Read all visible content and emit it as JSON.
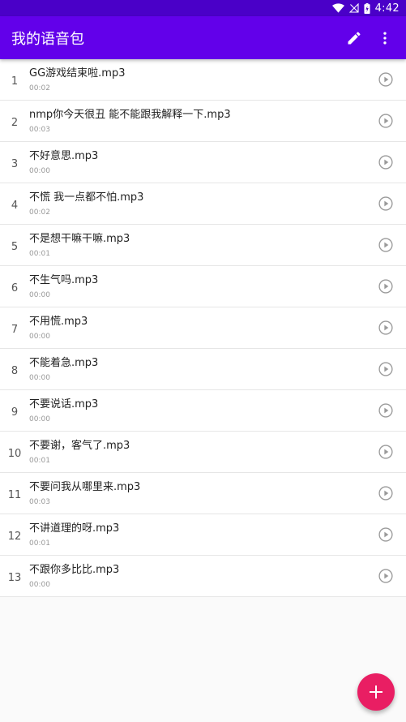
{
  "status_bar": {
    "time": "4:42",
    "icons": [
      "wifi-icon",
      "no-signal-icon",
      "battery-charging-icon"
    ]
  },
  "app_bar": {
    "title": "我的语音包",
    "actions": [
      "edit-icon",
      "more-vert-icon"
    ],
    "color": "#6200ea"
  },
  "list": {
    "items": [
      {
        "index": "1",
        "name": "GG游戏结束啦.mp3",
        "duration": "00:02"
      },
      {
        "index": "2",
        "name": "nmp你今天很丑 能不能跟我解释一下.mp3",
        "duration": "00:03"
      },
      {
        "index": "3",
        "name": "不好意思.mp3",
        "duration": "00:00"
      },
      {
        "index": "4",
        "name": "不慌 我一点都不怕.mp3",
        "duration": "00:02"
      },
      {
        "index": "5",
        "name": "不是想干嘛干嘛.mp3",
        "duration": "00:01"
      },
      {
        "index": "6",
        "name": "不生气吗.mp3",
        "duration": "00:00"
      },
      {
        "index": "7",
        "name": "不用慌.mp3",
        "duration": "00:00"
      },
      {
        "index": "8",
        "name": "不能着急.mp3",
        "duration": "00:00"
      },
      {
        "index": "9",
        "name": "不要说话.mp3",
        "duration": "00:00"
      },
      {
        "index": "10",
        "name": "不要谢，客气了.mp3",
        "duration": "00:01"
      },
      {
        "index": "11",
        "name": "不要问我从哪里来.mp3",
        "duration": "00:03"
      },
      {
        "index": "12",
        "name": "不讲道理的呀.mp3",
        "duration": "00:01"
      },
      {
        "index": "13",
        "name": "不跟你多比比.mp3",
        "duration": "00:00"
      }
    ]
  },
  "fab": {
    "icon": "add-icon",
    "label": "+",
    "color": "#e91e63"
  }
}
